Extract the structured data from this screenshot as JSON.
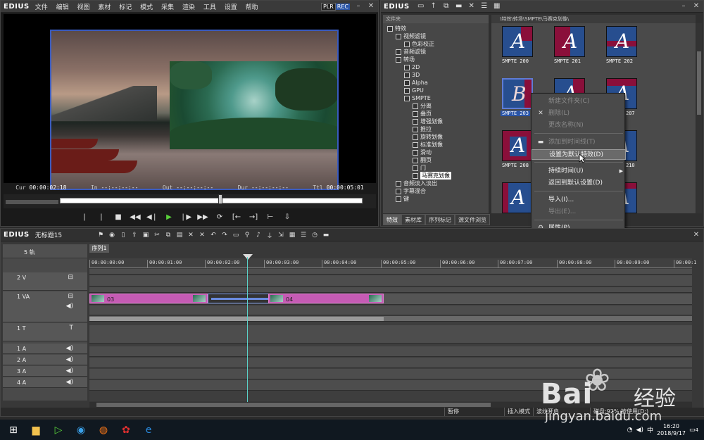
{
  "player": {
    "logo": "EDIUS",
    "menu": [
      "文件",
      "编辑",
      "视图",
      "素材",
      "标记",
      "模式",
      "采集",
      "渲染",
      "工具",
      "设置",
      "帮助"
    ],
    "plr": "PLR",
    "rec": "REC",
    "timecodes": [
      {
        "label": "Cur",
        "value": "00:00:02:18"
      },
      {
        "label": "In",
        "value": "--:--:--:--"
      },
      {
        "label": "Out",
        "value": "--:--:--:--"
      },
      {
        "label": "Dur",
        "value": "--:--:--:--"
      },
      {
        "label": "Ttl",
        "value": "00:00:05:01"
      }
    ]
  },
  "effects": {
    "logo": "EDIUS",
    "tree_header": "文件夹",
    "tree": [
      {
        "label": "特效"
      },
      {
        "label": "视频滤镜"
      },
      {
        "label": "色彩校正"
      },
      {
        "label": "音频滤镜"
      },
      {
        "label": "转场"
      },
      {
        "label": "2D"
      },
      {
        "label": "3D"
      },
      {
        "label": "Alpha"
      },
      {
        "label": "GPU"
      },
      {
        "label": "SMPTE"
      },
      {
        "label": "分离"
      },
      {
        "label": "叠页"
      },
      {
        "label": "增强划像"
      },
      {
        "label": "推拉"
      },
      {
        "label": "旋转划像"
      },
      {
        "label": "标准划像"
      },
      {
        "label": "滑动"
      },
      {
        "label": "翻页"
      },
      {
        "label": "门"
      },
      {
        "label": "马赛克划像"
      },
      {
        "label": "音频淡入淡出"
      },
      {
        "label": "字幕混合"
      },
      {
        "label": "键"
      }
    ],
    "path": "\\特效\\转场\\SMPTE\\马赛克划像\\",
    "tabs": [
      "特效",
      "素材库",
      "序列标记",
      "源文件浏览"
    ],
    "thumbs": [
      {
        "label": "SMPTE 200",
        "letter": "A"
      },
      {
        "label": "SMPTE 201",
        "letter": "A"
      },
      {
        "label": "SMPTE 202",
        "letter": "A"
      },
      {
        "label": "SMPTE 203",
        "letter": "B"
      },
      {
        "label": "",
        "letter": "A"
      },
      {
        "label": "207",
        "letter": "A"
      },
      {
        "label": "SMPTE 208",
        "letter": "A"
      },
      {
        "label": "",
        "letter": "A"
      },
      {
        "label": "210",
        "letter": "A"
      },
      {
        "label": "",
        "letter": "A"
      },
      {
        "label": "",
        "letter": "A"
      },
      {
        "label": "",
        "letter": "A"
      }
    ]
  },
  "context_menu": {
    "items": [
      {
        "label": "新建文件夹(C)",
        "icon": ""
      },
      {
        "label": "删除(L)",
        "icon": "✕"
      },
      {
        "label": "更改名称(N)",
        "icon": ""
      },
      {
        "label": "添加到时间线(T)",
        "icon": "▬"
      },
      {
        "label": "设置为默认特效(D)",
        "icon": ""
      },
      {
        "label": "持续时间(U)",
        "icon": ""
      },
      {
        "label": "返回到默认设置(D)",
        "icon": ""
      },
      {
        "label": "导入(I)...",
        "icon": ""
      },
      {
        "label": "导出(E)...",
        "icon": ""
      },
      {
        "label": "属性(P)...",
        "icon": "⚙"
      }
    ]
  },
  "timeline": {
    "logo": "EDIUS",
    "project": "无标题15",
    "sequence_tab": "序列1",
    "track_count": "5 轨",
    "ruler": [
      "00:00:00:00",
      "00:00:01:00",
      "00:00:02:00",
      "00:00:03:00",
      "00:00:04:00",
      "00:00:05:00",
      "00:00:06:00",
      "00:00:07:00",
      "00:00:08:00",
      "00:00:09:00",
      "00:00:1"
    ],
    "tracks": [
      {
        "name": "2 V"
      },
      {
        "name": "1 VA"
      },
      {
        "name": "1 T"
      },
      {
        "name": "1 A"
      },
      {
        "name": "2 A"
      },
      {
        "name": "3 A"
      },
      {
        "name": "4 A"
      }
    ],
    "clips": [
      {
        "label": "03"
      },
      {
        "label": "04"
      }
    ],
    "status": [
      "暂停",
      "插入模式",
      "波纹开启",
      "磁盘:92% 被使用(D:)"
    ]
  },
  "taskbar": {
    "tray_ime": "中",
    "time": "16:20",
    "date": "2018/9/17",
    "notif": "4"
  },
  "watermark": {
    "brand": "Bai",
    "brand2": "经验",
    "url": "jingyan.baidu.com"
  }
}
